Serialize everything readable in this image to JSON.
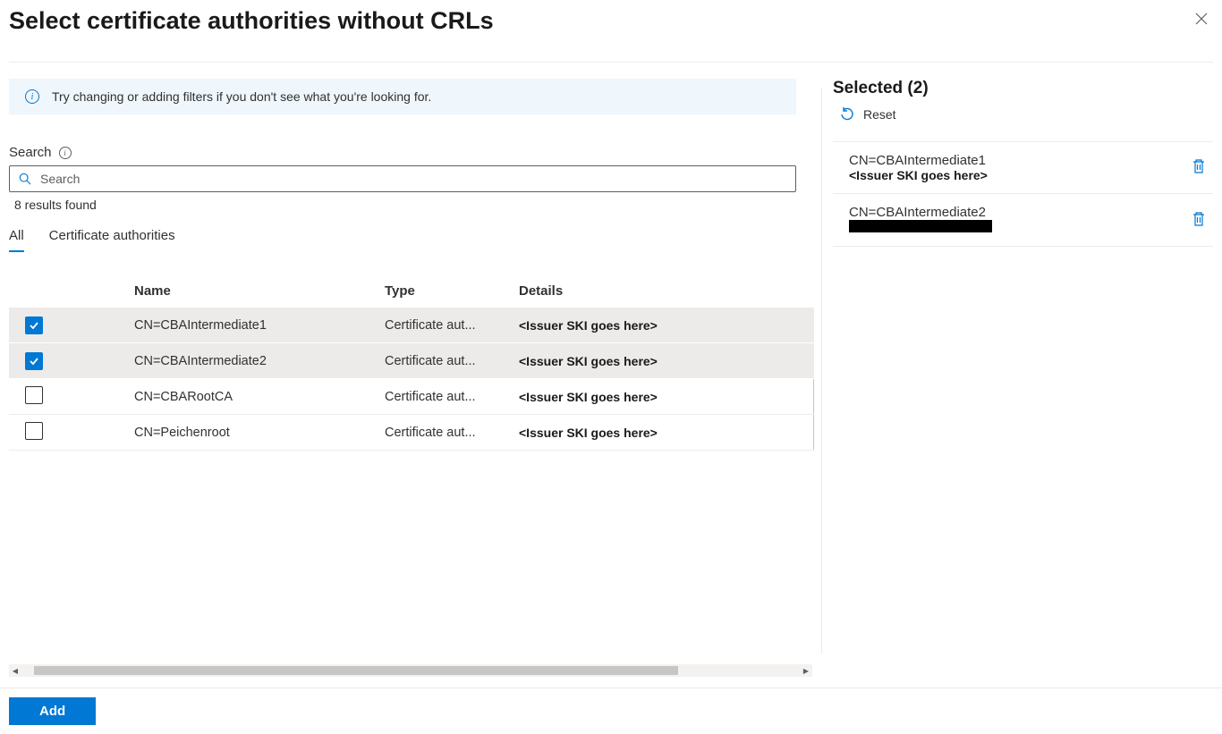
{
  "header": {
    "title": "Select certificate authorities without CRLs"
  },
  "banner": {
    "text": "Try changing or adding filters if you don't see what you're looking for."
  },
  "search": {
    "label": "Search",
    "placeholder": "Search",
    "results_text": "8 results found"
  },
  "tabs": {
    "all": "All",
    "ca": "Certificate authorities"
  },
  "table": {
    "headers": {
      "name": "Name",
      "type": "Type",
      "details": "Details"
    },
    "rows": [
      {
        "checked": true,
        "name": "CN=CBAIntermediate1",
        "type": "Certificate aut...",
        "details": "<Issuer SKI goes here>"
      },
      {
        "checked": true,
        "name": "CN=CBAIntermediate2",
        "type": "Certificate aut...",
        "details": "<Issuer SKI goes here>"
      },
      {
        "checked": false,
        "name": "CN=CBARootCA",
        "type": "Certificate aut...",
        "details": "<Issuer SKI goes here>"
      },
      {
        "checked": false,
        "name": "CN=Peichenroot",
        "type": "Certificate aut...",
        "details": "<Issuer SKI goes here>"
      }
    ]
  },
  "selected": {
    "title": "Selected (2)",
    "reset": "Reset",
    "items": [
      {
        "name": "CN=CBAIntermediate1",
        "detail": "<Issuer SKI goes here>",
        "redacted": false
      },
      {
        "name": "CN=CBAIntermediate2",
        "detail": "",
        "redacted": true
      }
    ]
  },
  "footer": {
    "add": "Add"
  }
}
